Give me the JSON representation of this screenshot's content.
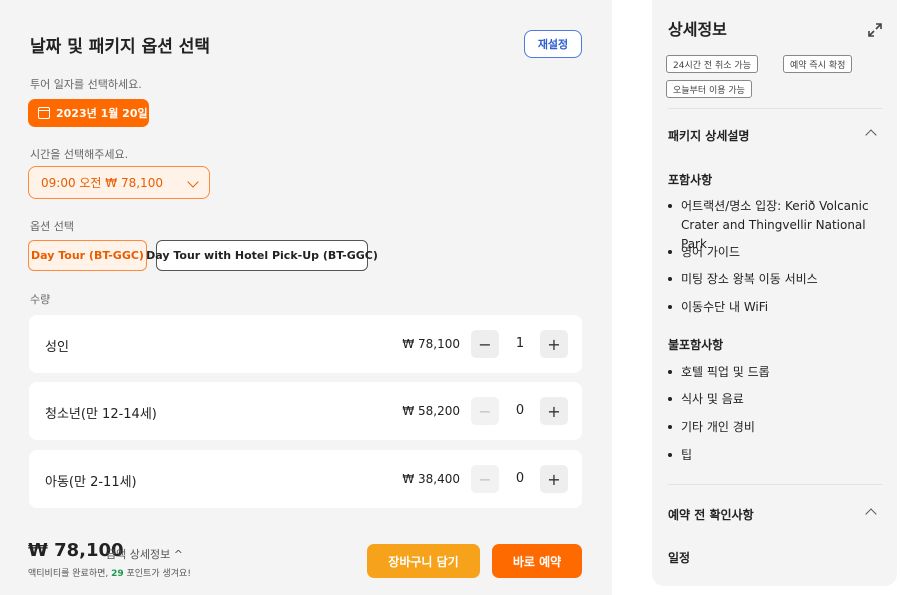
{
  "booking": {
    "title": "날짜 및 패키지 옵션 선택",
    "reset_label": "재설정",
    "date_prompt": "투어 일자를 선택하세요.",
    "date_value": "2023년 1월 20일",
    "time_prompt": "시간을 선택해주세요.",
    "time_value": "09:00 오전 ₩ 78,100",
    "option_prompt": "옵션 선택",
    "options": [
      {
        "label": "Day Tour (BT-GGC)",
        "selected": true
      },
      {
        "label": "Day Tour with Hotel Pick-Up (BT-GGC)",
        "selected": false
      }
    ],
    "quantity_prompt": "수량",
    "quantities": [
      {
        "name": "성인",
        "price": "₩ 78,100",
        "count": "1",
        "minus_enabled": true
      },
      {
        "name": "청소년(만 12-14세)",
        "price": "₩ 58,200",
        "count": "0",
        "minus_enabled": false
      },
      {
        "name": "아동(만 2-11세)",
        "price": "₩ 38,400",
        "count": "0",
        "minus_enabled": false
      }
    ],
    "minus_symbol": "−",
    "plus_symbol": "+",
    "total": "₩ 78,100",
    "total_detail_label": "금액 상세정보 ^",
    "points_before": "액티비티를 완료하면, ",
    "points_value": "29",
    "points_after": " 포인트가 생겨요!",
    "cart_label": "장바구니 담기",
    "book_label": "바로 예약"
  },
  "details": {
    "title": "상세정보",
    "tags": [
      "24시간 전 취소 가능",
      "예약 즉시 확정",
      "오늘부터 이용 가능"
    ],
    "package_section_title": "패키지 상세설명",
    "included_title": "포함사항",
    "included": [
      "어트랙션/명소 입장: Kerið Volcanic Crater and Thingvellir National Park",
      "영어 가이드",
      "미팅 장소 왕복 이동 서비스",
      "이동수단 내 WiFi"
    ],
    "excluded_title": "불포함사항",
    "excluded": [
      "호텔 픽업 및 드롭",
      "식사 및 음료",
      "기타 개인 경비",
      "팁"
    ],
    "notice_section_title": "예약 전 확인사항",
    "itinerary_title": "일정"
  },
  "colors": {
    "accent_orange": "#ff6a00",
    "cart_yellow": "#f7a21b",
    "reset_blue": "#2d5fd0",
    "points_green": "#1a9a4a"
  },
  "icons": [
    "calendar-icon",
    "chevron-down-icon",
    "expand-icon",
    "chevron-up-icon"
  ]
}
